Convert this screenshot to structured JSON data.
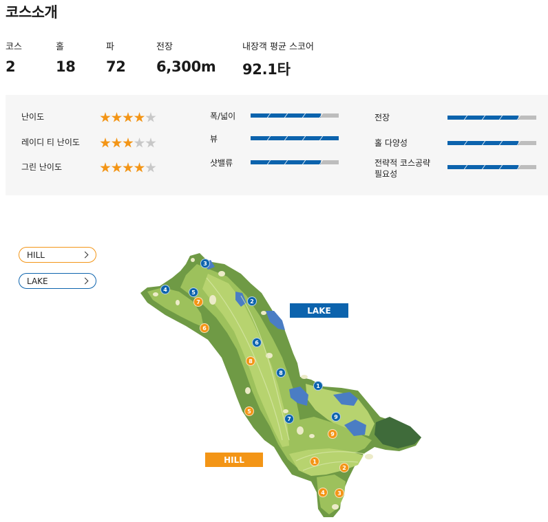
{
  "page": {
    "title": "코스소개"
  },
  "stats": [
    {
      "label": "코스",
      "value": "2"
    },
    {
      "label": "홀",
      "value": "18"
    },
    {
      "label": "파",
      "value": "72"
    },
    {
      "label": "전장",
      "value": "6,300m"
    },
    {
      "label": "내장객 평균 스코어",
      "value": "92.1타"
    }
  ],
  "ratings": {
    "stars": [
      {
        "label": "난이도",
        "score": 4,
        "max": 5
      },
      {
        "label": "레이디 티 난이도",
        "score": 3,
        "max": 5
      },
      {
        "label": "그린 난이도",
        "score": 4,
        "max": 5
      }
    ],
    "bars_middle": [
      {
        "label": "폭/넓이",
        "level": 0.8
      },
      {
        "label": "뷰",
        "level": 1.0
      },
      {
        "label": "샷밸류",
        "level": 0.8
      }
    ],
    "bars_right": [
      {
        "label": "전장",
        "level": 0.8
      },
      {
        "label": "홀 다양성",
        "level": 0.8
      },
      {
        "label": "전략적 코스공략",
        "label2": "필요성",
        "level": 0.8
      }
    ],
    "star_on_color": "#f39516",
    "star_off_color": "#c8c8c8",
    "bar_color": "#0c63ad"
  },
  "courses": {
    "hill_button": "HILL",
    "lake_button": "LAKE",
    "hill_color": "#f39516",
    "lake_color": "#0c63ad"
  },
  "map": {
    "lake_tag": "LAKE",
    "hill_tag": "HILL",
    "lake_holes": [
      "1",
      "2",
      "3",
      "4",
      "5",
      "6",
      "7",
      "8",
      "9"
    ],
    "hill_holes": [
      "1",
      "2",
      "3",
      "4",
      "5",
      "6",
      "7",
      "8",
      "9"
    ]
  }
}
